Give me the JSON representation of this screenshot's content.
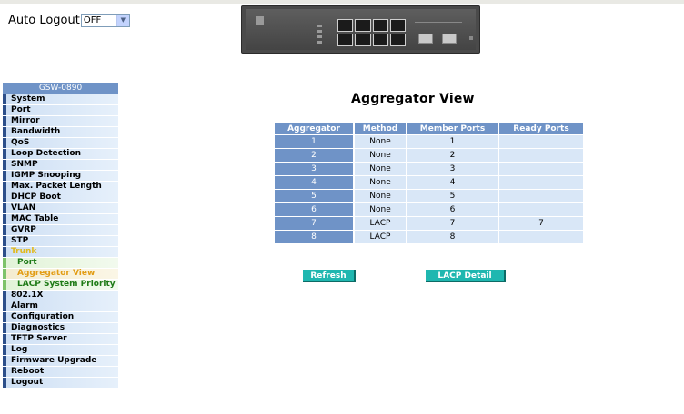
{
  "auto_logout": {
    "label": "Auto Logout",
    "value": "OFF"
  },
  "sidebar": {
    "model": "GSW-0890",
    "items": [
      {
        "label": "System",
        "type": "top"
      },
      {
        "label": "Port",
        "type": "top"
      },
      {
        "label": "Mirror",
        "type": "top"
      },
      {
        "label": "Bandwidth",
        "type": "top"
      },
      {
        "label": "QoS",
        "type": "top"
      },
      {
        "label": "Loop Detection",
        "type": "top"
      },
      {
        "label": "SNMP",
        "type": "top"
      },
      {
        "label": "IGMP Snooping",
        "type": "top"
      },
      {
        "label": "Max. Packet Length",
        "type": "top"
      },
      {
        "label": "DHCP Boot",
        "type": "top"
      },
      {
        "label": "VLAN",
        "type": "top"
      },
      {
        "label": "MAC Table",
        "type": "top"
      },
      {
        "label": "GVRP",
        "type": "top"
      },
      {
        "label": "STP",
        "type": "top"
      },
      {
        "label": "Trunk",
        "type": "active"
      },
      {
        "label": "Port",
        "type": "sub"
      },
      {
        "label": "Aggregator View",
        "type": "sub-current"
      },
      {
        "label": "LACP System Priority",
        "type": "sub"
      },
      {
        "label": "802.1X",
        "type": "top"
      },
      {
        "label": "Alarm",
        "type": "top"
      },
      {
        "label": "Configuration",
        "type": "top"
      },
      {
        "label": "Diagnostics",
        "type": "top"
      },
      {
        "label": "TFTP Server",
        "type": "top"
      },
      {
        "label": "Log",
        "type": "top"
      },
      {
        "label": "Firmware Upgrade",
        "type": "top"
      },
      {
        "label": "Reboot",
        "type": "top"
      },
      {
        "label": "Logout",
        "type": "top"
      }
    ]
  },
  "main": {
    "title": "Aggregator View",
    "columns": [
      "Aggregator",
      "Method",
      "Member Ports",
      "Ready Ports"
    ],
    "rows": [
      {
        "aggregator": "1",
        "method": "None",
        "member": "1",
        "ready": ""
      },
      {
        "aggregator": "2",
        "method": "None",
        "member": "2",
        "ready": ""
      },
      {
        "aggregator": "3",
        "method": "None",
        "member": "3",
        "ready": ""
      },
      {
        "aggregator": "4",
        "method": "None",
        "member": "4",
        "ready": ""
      },
      {
        "aggregator": "5",
        "method": "None",
        "member": "5",
        "ready": ""
      },
      {
        "aggregator": "6",
        "method": "None",
        "member": "6",
        "ready": ""
      },
      {
        "aggregator": "7",
        "method": "LACP",
        "member": "7",
        "ready": "7"
      },
      {
        "aggregator": "8",
        "method": "LACP",
        "member": "8",
        "ready": ""
      }
    ],
    "buttons": {
      "refresh": "Refresh",
      "lacp_detail": "LACP Detail"
    }
  },
  "colors": {
    "header_blue": "#6f93c7",
    "cell_light": "#d9e7f7",
    "button_teal": "#1fb7b0",
    "active_yellow": "#e1b91c",
    "sub_green": "#1d7a16"
  }
}
